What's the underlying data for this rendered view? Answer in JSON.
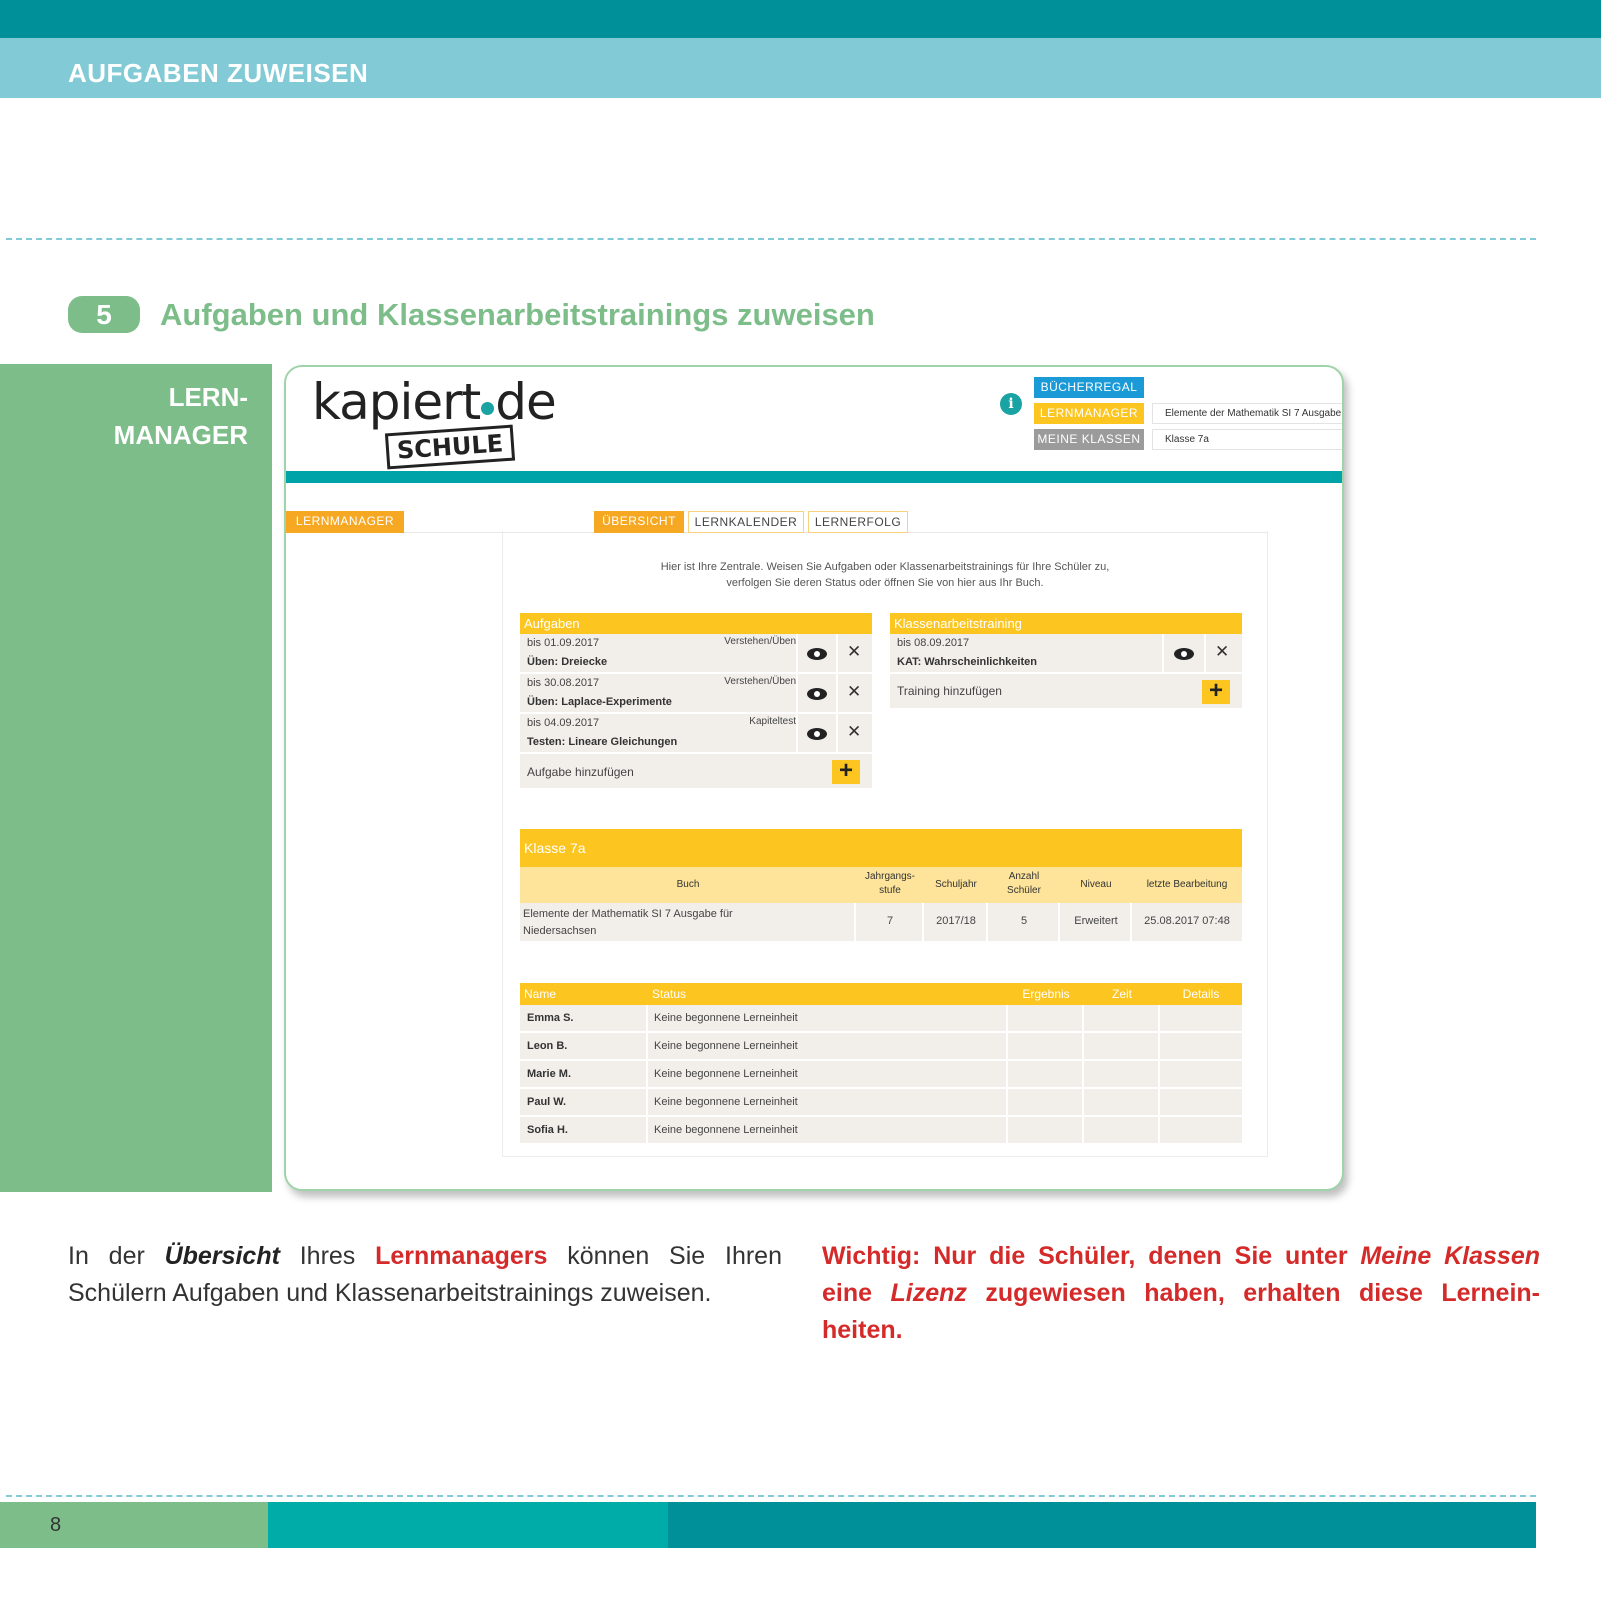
{
  "header": {
    "title": "AUFGABEN ZUWEISEN"
  },
  "section": {
    "number": "5",
    "title": "Aufgaben und Klassenarbeitstrainings zuweisen"
  },
  "sidebar": {
    "line1": "LERN-",
    "line2": "MANAGER"
  },
  "app": {
    "logo_main": "kapiert",
    "logo_suffix": "de",
    "logo_sub": "SCHULE",
    "info_icon": "i",
    "nav": {
      "bucherregal": "BÜCHERREGAL",
      "lernmanager": "LERNMANAGER",
      "meine_klassen": "MEINE KLASSEN",
      "book_select": "Elemente der Mathematik SI 7 Ausgabe",
      "class_select": "Klasse 7a"
    },
    "colors": {
      "teal": "#00a4a8",
      "yellow": "#fcc520",
      "blue": "#1a9ad6",
      "gray": "#9b9b9b",
      "orange": "#f7a823"
    },
    "section_label": "LERNMANAGER",
    "tabs": [
      "ÜBERSICHT",
      "LERNKALENDER",
      "LERNERFOLG"
    ],
    "intro_line1": "Hier ist Ihre Zentrale. Weisen Sie Aufgaben oder Klassenarbeitstrainings für Ihre Schüler zu,",
    "intro_line2": "verfolgen Sie deren Status oder öffnen Sie von hier aus Ihr Buch.",
    "aufgaben": {
      "title": "Aufgaben",
      "add_label": "Aufgabe hinzufügen",
      "items": [
        {
          "date": "bis 01.09.2017",
          "type": "Verstehen/Üben",
          "name": "Üben: Dreiecke"
        },
        {
          "date": "bis 30.08.2017",
          "type": "Verstehen/Üben",
          "name": "Üben: Laplace-Experimente"
        },
        {
          "date": "bis 04.09.2017",
          "type": "Kapiteltest",
          "name": "Testen: Lineare Gleichungen"
        }
      ]
    },
    "training": {
      "title": "Klassenarbeitstraining",
      "add_label": "Training hinzufügen",
      "items": [
        {
          "date": "bis 08.09.2017",
          "name": "KAT: Wahrscheinlichkeiten"
        }
      ]
    },
    "klasse": {
      "title": "Klasse 7a",
      "headers": {
        "buch": "Buch",
        "stufe1": "Jahrgangs-",
        "stufe2": "stufe",
        "schuljahr": "Schuljahr",
        "anzahl1": "Anzahl",
        "anzahl2": "Schüler",
        "niveau": "Niveau",
        "letzte": "letzte Bearbeitung"
      },
      "row": {
        "buch1": "Elemente der Mathematik SI 7 Ausgabe für",
        "buch2": "Niedersachsen",
        "stufe": "7",
        "schuljahr": "2017/18",
        "anzahl": "5",
        "niveau": "Erweitert",
        "letzte": "25.08.2017 07:48"
      }
    },
    "students": {
      "headers": {
        "name": "Name",
        "status": "Status",
        "ergebnis": "Ergebnis",
        "zeit": "Zeit",
        "details": "Details"
      },
      "rows": [
        {
          "name": "Emma S.",
          "status": "Keine begonnene Lerneinheit"
        },
        {
          "name": "Leon B.",
          "status": "Keine begonnene Lerneinheit"
        },
        {
          "name": "Marie M.",
          "status": "Keine begonnene Lerneinheit"
        },
        {
          "name": "Paul W.",
          "status": "Keine begonnene Lerneinheit"
        },
        {
          "name": "Sofia H.",
          "status": "Keine begonnene Lerneinheit"
        }
      ]
    }
  },
  "body_left": {
    "p1": "In der ",
    "b1": "Übersicht",
    "p2": " Ihres ",
    "b2": "Lernmanagers",
    "p3": " können Sie Ihren Schülern Aufgaben und Klassenarbeitstrainings zuweisen."
  },
  "body_right": {
    "p1": "Wichtig: Nur die Schüler, denen Sie unter ",
    "i1": "Meine Klassen",
    "p2": " eine ",
    "i2": "Lizenz",
    "p3": " zugewiesen haben, erhalten diese Lernein-heiten."
  },
  "footer": {
    "page_number": "8"
  }
}
